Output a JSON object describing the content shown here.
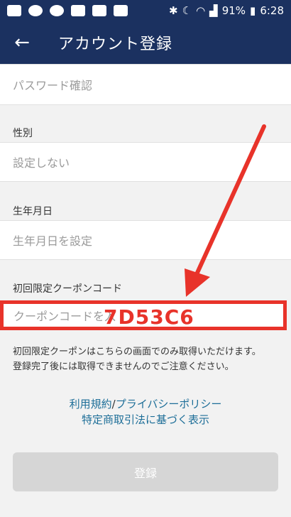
{
  "status_bar": {
    "battery": "91%",
    "time": "6:28",
    "icons": [
      "message-icon",
      "chat-icon",
      "line-icon",
      "photo-icon",
      "twitter-icon",
      "twitter-icon",
      "bluetooth-icon",
      "moon-icon",
      "wifi-icon",
      "signal-icon",
      "battery-icon"
    ]
  },
  "header": {
    "back_icon": "←",
    "title": "アカウント登録"
  },
  "form": {
    "password_confirm_placeholder": "パスワード確認",
    "gender_label": "性別",
    "gender_value": "設定しない",
    "birthday_label": "生年月日",
    "birthday_placeholder": "生年月日を設定",
    "coupon_label": "初回限定クーポンコード",
    "coupon_placeholder": "クーポンコードを入",
    "coupon_code": "7D53C6",
    "coupon_note_1": "初回限定クーポンはこちらの画面でのみ取得いただけます。",
    "coupon_note_2": "登録完了後には取得できませんのでご注意ください。"
  },
  "links": {
    "terms": "利用規約",
    "separator": "/",
    "privacy": "プライバシーポリシー",
    "commerce": "特定商取引法に基づく表示"
  },
  "actions": {
    "register_label": "登録"
  },
  "colors": {
    "header_bg": "#1b3160",
    "highlight_red": "#e8332a",
    "link_blue": "#1d6e98"
  }
}
